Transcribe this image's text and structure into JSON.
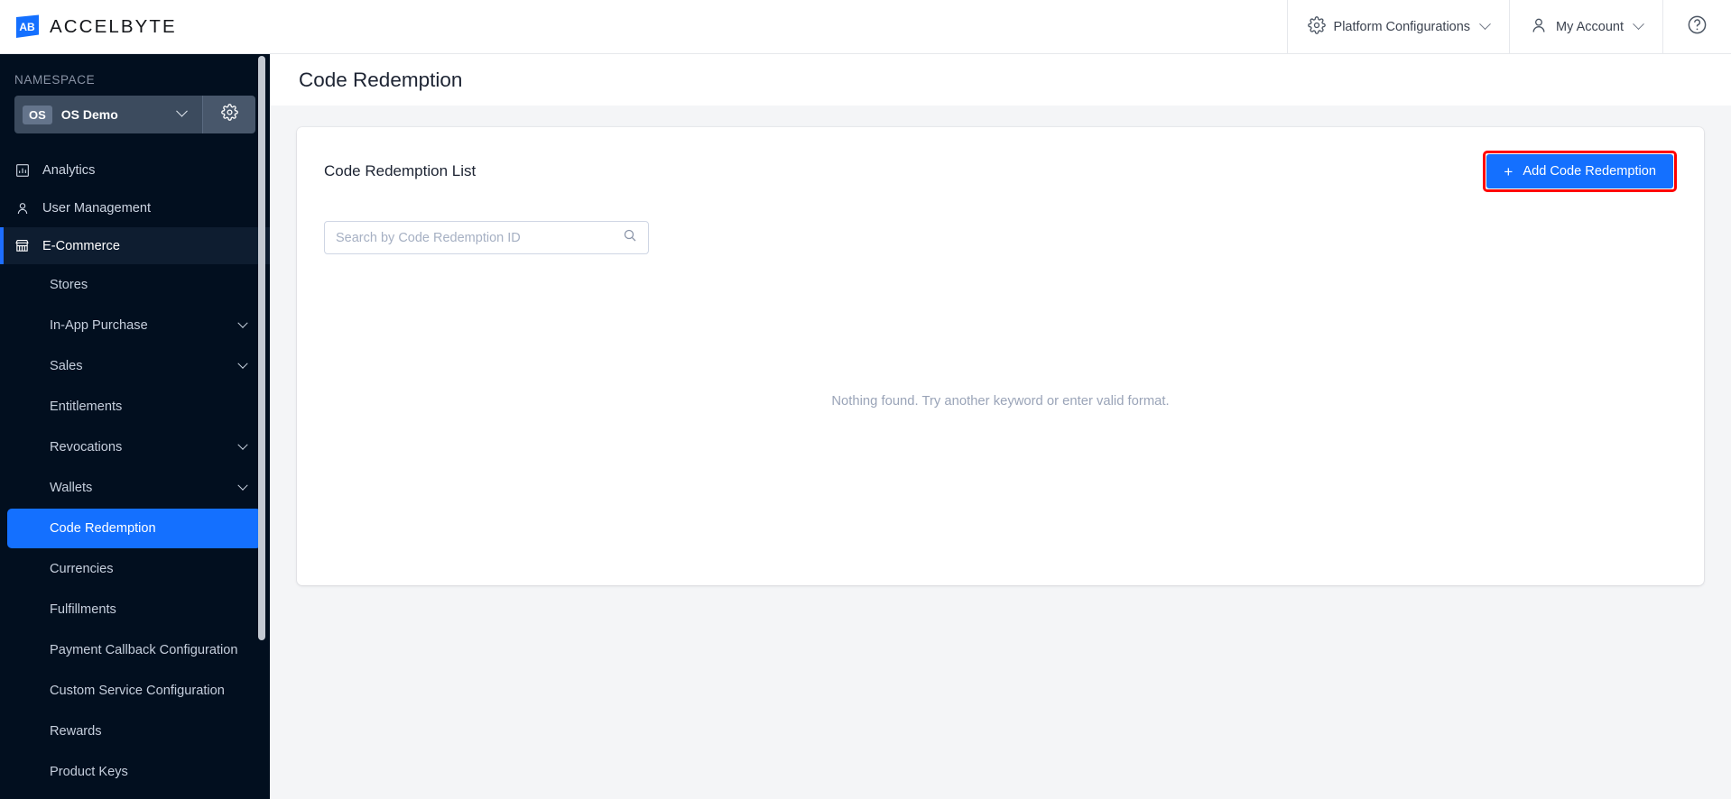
{
  "topbar": {
    "logo": {
      "icon": "accelbyte-logo-icon",
      "wordmark": "ACCELBYTE"
    },
    "platform_configurations": {
      "icon": "gear-icon",
      "label": "Platform Configurations"
    },
    "my_account": {
      "icon": "user-icon",
      "label": "My Account"
    },
    "help": {
      "icon": "help-circle-icon"
    }
  },
  "sidebar": {
    "namespace_label": "NAMESPACE",
    "namespace": {
      "badge": "OS",
      "name": "OS Demo",
      "settings_icon": "gear-icon",
      "chevron": "chevron-down-icon"
    },
    "items": [
      {
        "label": "Analytics",
        "icon": "bar-chart-icon",
        "active": false,
        "expandable": false
      },
      {
        "label": "User Management",
        "icon": "user-icon",
        "active": false,
        "expandable": false
      },
      {
        "label": "E-Commerce",
        "icon": "store-icon",
        "active": true,
        "expandable": false
      }
    ],
    "sub_items": [
      {
        "label": "Stores",
        "expandable": false,
        "selected": false
      },
      {
        "label": "In-App Purchase",
        "expandable": true,
        "selected": false
      },
      {
        "label": "Sales",
        "expandable": true,
        "selected": false
      },
      {
        "label": "Entitlements",
        "expandable": false,
        "selected": false
      },
      {
        "label": "Revocations",
        "expandable": true,
        "selected": false
      },
      {
        "label": "Wallets",
        "expandable": true,
        "selected": false
      },
      {
        "label": "Code Redemption",
        "expandable": false,
        "selected": true
      },
      {
        "label": "Currencies",
        "expandable": false,
        "selected": false
      },
      {
        "label": "Fulfillments",
        "expandable": false,
        "selected": false
      },
      {
        "label": "Payment Callback Configuration",
        "expandable": false,
        "selected": false
      },
      {
        "label": "Custom Service Configuration",
        "expandable": false,
        "selected": false
      },
      {
        "label": "Rewards",
        "expandable": false,
        "selected": false
      },
      {
        "label": "Product Keys",
        "expandable": false,
        "selected": false
      }
    ]
  },
  "main": {
    "page_title": "Code Redemption",
    "card": {
      "title": "Code Redemption List",
      "add_button": {
        "label": "Add Code Redemption",
        "plus": "+",
        "highlighted": true
      },
      "search": {
        "placeholder": "Search by Code Redemption ID",
        "value": "",
        "icon": "search-icon"
      },
      "empty_message": "Nothing found. Try another keyword or enter valid format."
    }
  },
  "colors": {
    "accent_blue": "#1470ff",
    "sidebar_bg": "#020f1f",
    "sidebar_active_bg": "#0e1d30",
    "highlight_red": "#ff0000",
    "page_bg": "#f4f5f7",
    "namespace_bg": "#3c4b5e"
  }
}
